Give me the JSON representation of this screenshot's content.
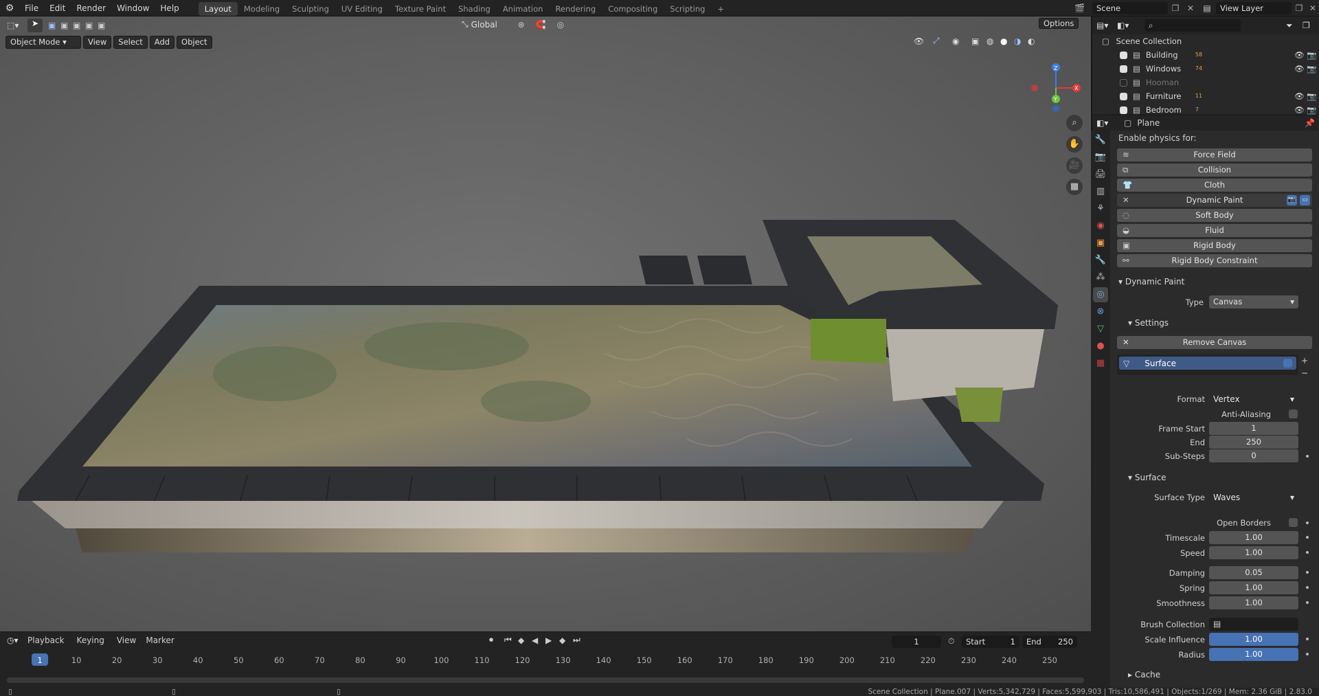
{
  "topbar": {
    "menus": [
      "File",
      "Edit",
      "Render",
      "Window",
      "Help"
    ],
    "workspaces": [
      "Layout",
      "Modeling",
      "Sculpting",
      "UV Editing",
      "Texture Paint",
      "Shading",
      "Animation",
      "Rendering",
      "Compositing",
      "Scripting"
    ],
    "active_workspace": "Layout",
    "add_tab": "+",
    "scene_label": "Scene",
    "view_layer_label": "View Layer"
  },
  "viewport": {
    "mode": "Object Mode",
    "menus": [
      "View",
      "Select",
      "Add",
      "Object"
    ],
    "transform_orientation": "Global",
    "options_label": "Options",
    "gizmo_axes": [
      "X",
      "Y",
      "Z"
    ]
  },
  "outliner": {
    "root": "Scene Collection",
    "items": [
      {
        "name": "Building",
        "checked": true,
        "count": "58"
      },
      {
        "name": "Windows",
        "checked": true,
        "count": "74"
      },
      {
        "name": "Hooman",
        "checked": false,
        "count": ""
      },
      {
        "name": "Furniture",
        "checked": true,
        "count": "11"
      },
      {
        "name": "Bedroom",
        "checked": true,
        "count": "7"
      }
    ]
  },
  "properties": {
    "object_name": "Plane",
    "enable_physics_label": "Enable physics for:",
    "physics_buttons": [
      "Force Field",
      "Collision",
      "Cloth",
      "Dynamic Paint",
      "Soft Body",
      "Fluid",
      "Rigid Body",
      "Rigid Body Constraint"
    ],
    "dynamic_paint_section": "Dynamic Paint",
    "type_label": "Type",
    "type_value": "Canvas",
    "settings_section": "Settings",
    "remove_canvas": "Remove Canvas",
    "surface_item": "Surface",
    "format_label": "Format",
    "format_value": "Vertex",
    "anti_aliasing_label": "Anti-Aliasing",
    "frame_start_label": "Frame Start",
    "frame_start": "1",
    "end_label": "End",
    "end_value": "250",
    "substeps_label": "Sub-Steps",
    "substeps": "0",
    "surface_section": "Surface",
    "surface_type_label": "Surface Type",
    "surface_type": "Waves",
    "open_borders_label": "Open Borders",
    "timescale_label": "Timescale",
    "timescale": "1.00",
    "speed_label": "Speed",
    "speed": "1.00",
    "damping_label": "Damping",
    "damping": "0.05",
    "spring_label": "Spring",
    "spring": "1.00",
    "smoothness_label": "Smoothness",
    "smoothness": "1.00",
    "brush_collection_label": "Brush Collection",
    "scale_influence_label": "Scale Influence",
    "scale_influence": "1.00",
    "radius_label": "Radius",
    "radius": "1.00",
    "cache_section": "Cache"
  },
  "timeline": {
    "menus": [
      "Playback",
      "Keying",
      "View",
      "Marker"
    ],
    "current_frame": "1",
    "start_label": "Start",
    "start": "1",
    "end_label": "End",
    "end": "250",
    "ticks": [
      "1",
      "10",
      "20",
      "30",
      "40",
      "50",
      "60",
      "70",
      "80",
      "90",
      "100",
      "110",
      "120",
      "130",
      "140",
      "150",
      "160",
      "170",
      "180",
      "190",
      "200",
      "210",
      "220",
      "230",
      "240",
      "250"
    ]
  },
  "statusbar": {
    "text": "Scene Collection | Plane.007 | Verts:5,342,729 | Faces:5,599,903 | Tris:10,586,491 | Objects:1/269 | Mem: 2.36 GiB | 2.83.0"
  }
}
